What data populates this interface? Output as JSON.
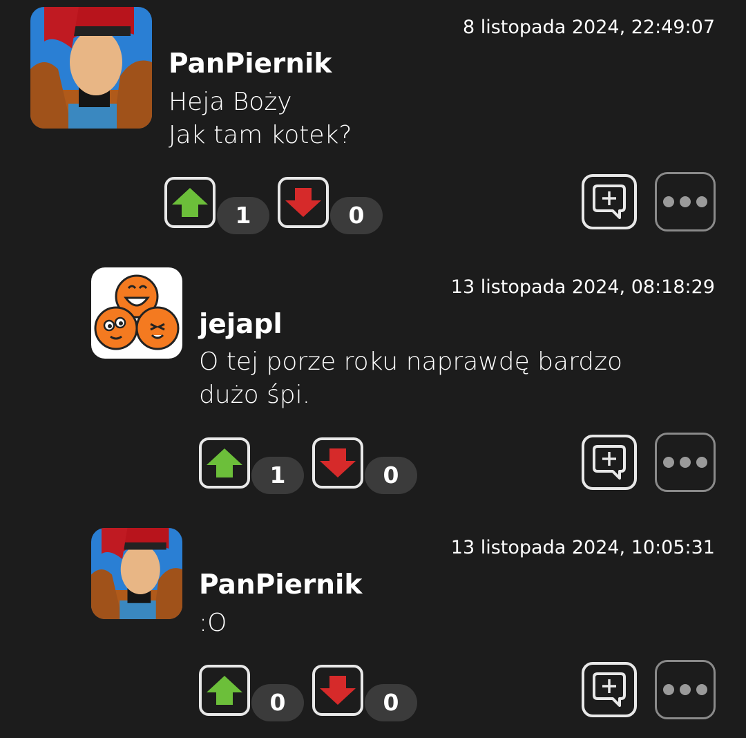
{
  "comments": [
    {
      "author": "PanPiernik",
      "timestamp": "8 listopada 2024, 22:49:07",
      "lines": [
        "Heja Boży",
        "Jak tam kotek?"
      ],
      "upvotes": "1",
      "downvotes": "0",
      "avatar": "gambit-avatar-icon"
    },
    {
      "author": "jejapl",
      "timestamp": "13 listopada 2024, 08:18:29",
      "lines": [
        "O tej porze roku naprawdę bardzo",
        "dużo śpi."
      ],
      "upvotes": "1",
      "downvotes": "0",
      "avatar": "jeja-logo-icon"
    },
    {
      "author": "PanPiernik",
      "timestamp": "13 listopada 2024, 10:05:31",
      "lines": [
        ":O"
      ],
      "upvotes": "0",
      "downvotes": "0",
      "avatar": "gambit-avatar-icon"
    }
  ],
  "colors": {
    "background": "#1c1c1c",
    "upvote": "#6cbf3a",
    "downvote": "#d62a2a",
    "count_bg": "#3b3b3b",
    "jeja_orange": "#f47a20"
  },
  "icons": {
    "upvote": "arrow-up-icon",
    "downvote": "arrow-down-icon",
    "reply": "reply-plus-icon",
    "more": "more-dots-icon"
  }
}
